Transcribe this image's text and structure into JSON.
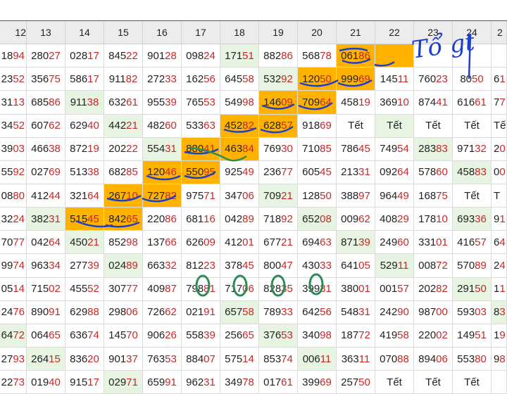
{
  "header_days": [
    "12",
    "13",
    "14",
    "15",
    "16",
    "17",
    "18",
    "19",
    "20",
    "21",
    "22",
    "23",
    "24",
    "2"
  ],
  "tet_label": "Tết",
  "rows": [
    [
      [
        "18",
        "94"
      ],
      [
        "280",
        "27"
      ],
      [
        "028",
        "17"
      ],
      [
        "845",
        "22"
      ],
      [
        "901",
        "28"
      ],
      [
        "098",
        "24"
      ],
      [
        "171",
        "51"
      ],
      [
        "882",
        "86"
      ],
      [
        "568",
        "78"
      ],
      [
        "061",
        "86"
      ],
      [
        "",
        ""
      ],
      [
        "",
        ""
      ],
      [
        "",
        ""
      ],
      [
        "",
        ""
      ]
    ],
    [
      [
        "23",
        "52"
      ],
      [
        "356",
        "75"
      ],
      [
        "586",
        "17"
      ],
      [
        "911",
        "82"
      ],
      [
        "272",
        "33"
      ],
      [
        "162",
        "56"
      ],
      [
        "645",
        "58"
      ],
      [
        "532",
        "92"
      ],
      [
        "120",
        "50"
      ],
      [
        "999",
        "69"
      ],
      [
        "145",
        "11"
      ],
      [
        "760",
        "23"
      ],
      [
        "80",
        "50"
      ],
      [
        "6",
        "1"
      ]
    ],
    [
      [
        "31",
        "13"
      ],
      [
        "685",
        "86"
      ],
      [
        "911",
        "38"
      ],
      [
        "632",
        "61"
      ],
      [
        "955",
        "39"
      ],
      [
        "765",
        "53"
      ],
      [
        "549",
        "98"
      ],
      [
        "146",
        "09"
      ],
      [
        "709",
        "64"
      ],
      [
        "458",
        "19"
      ],
      [
        "369",
        "10"
      ],
      [
        "874",
        "41"
      ],
      [
        "616",
        "61"
      ],
      [
        "7",
        "7"
      ]
    ],
    [
      [
        "34",
        "52"
      ],
      [
        "607",
        "62"
      ],
      [
        "629",
        "40"
      ],
      [
        "442",
        "21"
      ],
      [
        "482",
        "60"
      ],
      [
        "533",
        "63"
      ],
      [
        "452",
        "82"
      ],
      [
        "628",
        "57"
      ],
      [
        "918",
        "69"
      ],
      [
        "Tết",
        ""
      ],
      [
        "Tết",
        ""
      ],
      [
        "Tết",
        ""
      ],
      [
        "Tết",
        ""
      ],
      [
        "Tết",
        ""
      ]
    ],
    [
      [
        "39",
        "03"
      ],
      [
        "466",
        "38"
      ],
      [
        "872",
        "19"
      ],
      [
        "202",
        "22"
      ],
      [
        "554",
        "31"
      ],
      [
        "880",
        "41"
      ],
      [
        "463",
        "84"
      ],
      [
        "769",
        "30"
      ],
      [
        "710",
        "85"
      ],
      [
        "786",
        "45"
      ],
      [
        "749",
        "54"
      ],
      [
        "283",
        "83"
      ],
      [
        "971",
        "32"
      ],
      [
        "2",
        "0"
      ]
    ],
    [
      [
        "55",
        "92"
      ],
      [
        "027",
        "69"
      ],
      [
        "513",
        "38"
      ],
      [
        "682",
        "85"
      ],
      [
        "120",
        "46"
      ],
      [
        "550",
        "95"
      ],
      [
        "925",
        "49"
      ],
      [
        "236",
        "77"
      ],
      [
        "605",
        "45"
      ],
      [
        "213",
        "31"
      ],
      [
        "092",
        "64"
      ],
      [
        "578",
        "60"
      ],
      [
        "458",
        "83"
      ],
      [
        "0",
        "0"
      ]
    ],
    [
      [
        "08",
        "80"
      ],
      [
        "412",
        "44"
      ],
      [
        "321",
        "64"
      ],
      [
        "267",
        "10"
      ],
      [
        "727",
        "82"
      ],
      [
        "975",
        "71"
      ],
      [
        "347",
        "06"
      ],
      [
        "709",
        "21"
      ],
      [
        "128",
        "50"
      ],
      [
        "388",
        "97"
      ],
      [
        "964",
        "49"
      ],
      [
        "168",
        "75"
      ],
      [
        "Tết",
        ""
      ],
      [
        "T",
        ""
      ]
    ],
    [
      [
        "32",
        "24"
      ],
      [
        "382",
        "31"
      ],
      [
        "515",
        "45"
      ],
      [
        "842",
        "65"
      ],
      [
        "220",
        "86"
      ],
      [
        "681",
        "16"
      ],
      [
        "042",
        "89"
      ],
      [
        "718",
        "92"
      ],
      [
        "652",
        "08"
      ],
      [
        "009",
        "62"
      ],
      [
        "408",
        "29"
      ],
      [
        "178",
        "10"
      ],
      [
        "693",
        "36"
      ],
      [
        "9",
        "1"
      ]
    ],
    [
      [
        "70",
        "77"
      ],
      [
        "042",
        "64"
      ],
      [
        "450",
        "21"
      ],
      [
        "852",
        "98"
      ],
      [
        "137",
        "66"
      ],
      [
        "626",
        "09"
      ],
      [
        "412",
        "01"
      ],
      [
        "677",
        "21"
      ],
      [
        "694",
        "63"
      ],
      [
        "871",
        "39"
      ],
      [
        "249",
        "60"
      ],
      [
        "331",
        "01"
      ],
      [
        "416",
        "57"
      ],
      [
        "6",
        "4"
      ]
    ],
    [
      [
        "99",
        "74"
      ],
      [
        "963",
        "34"
      ],
      [
        "277",
        "39"
      ],
      [
        "024",
        "89"
      ],
      [
        "663",
        "32"
      ],
      [
        "812",
        "23"
      ],
      [
        "378",
        "45"
      ],
      [
        "800",
        "47"
      ],
      [
        "430",
        "33"
      ],
      [
        "641",
        "05"
      ],
      [
        "529",
        "11"
      ],
      [
        "008",
        "72"
      ],
      [
        "570",
        "89"
      ],
      [
        "2",
        "4"
      ]
    ],
    [
      [
        "05",
        "14"
      ],
      [
        "715",
        "02"
      ],
      [
        "455",
        "52"
      ],
      [
        "307",
        "77"
      ],
      [
        "409",
        "87"
      ],
      [
        "798",
        "81"
      ],
      [
        "717",
        "06"
      ],
      [
        "828",
        "35"
      ],
      [
        "399",
        "31"
      ],
      [
        "380",
        "01"
      ],
      [
        "001",
        "57"
      ],
      [
        "202",
        "82"
      ],
      [
        "291",
        "50"
      ],
      [
        "1",
        "1"
      ]
    ],
    [
      [
        "24",
        "76"
      ],
      [
        "890",
        "91"
      ],
      [
        "629",
        "88"
      ],
      [
        "298",
        "06"
      ],
      [
        "726",
        "62"
      ],
      [
        "021",
        "91"
      ],
      [
        "657",
        "58"
      ],
      [
        "789",
        "33"
      ],
      [
        "642",
        "56"
      ],
      [
        "548",
        "31"
      ],
      [
        "242",
        "90"
      ],
      [
        "987",
        "00"
      ],
      [
        "593",
        "03"
      ],
      [
        "8",
        "3"
      ]
    ],
    [
      [
        "64",
        "72"
      ],
      [
        "064",
        "65"
      ],
      [
        "636",
        "74"
      ],
      [
        "145",
        "70"
      ],
      [
        "906",
        "26"
      ],
      [
        "558",
        "39"
      ],
      [
        "256",
        "65"
      ],
      [
        "376",
        "53"
      ],
      [
        "340",
        "98"
      ],
      [
        "187",
        "72"
      ],
      [
        "419",
        "58"
      ],
      [
        "220",
        "02"
      ],
      [
        "149",
        "51"
      ],
      [
        "1",
        "9"
      ]
    ],
    [
      [
        "27",
        "93"
      ],
      [
        "264",
        "15"
      ],
      [
        "836",
        "20"
      ],
      [
        "901",
        "37"
      ],
      [
        "763",
        "53"
      ],
      [
        "884",
        "07"
      ],
      [
        "575",
        "14"
      ],
      [
        "853",
        "74"
      ],
      [
        "006",
        "11"
      ],
      [
        "363",
        "11"
      ],
      [
        "070",
        "88"
      ],
      [
        "894",
        "06"
      ],
      [
        "553",
        "80"
      ],
      [
        "9",
        "8"
      ]
    ],
    [
      [
        "22",
        "73"
      ],
      [
        "019",
        "40"
      ],
      [
        "915",
        "17"
      ],
      [
        "029",
        "71"
      ],
      [
        "659",
        "91"
      ],
      [
        "962",
        "31"
      ],
      [
        "349",
        "78"
      ],
      [
        "017",
        "61"
      ],
      [
        "399",
        "69"
      ],
      [
        "257",
        "50"
      ],
      [
        "Tết",
        ""
      ],
      [
        "Tết",
        ""
      ],
      [
        "Tết",
        ""
      ],
      [
        "",
        ""
      ]
    ]
  ],
  "annotations": {
    "handwriting_text": "Tổ gt",
    "ink_blue": "#1d3fc9",
    "ink_green": "#2e8b57"
  },
  "colors": {
    "highlight_orange": "#ffb300",
    "highlight_green": "#e7f4e1",
    "tail_red": "#c62828",
    "header_bg": "#ececec"
  }
}
